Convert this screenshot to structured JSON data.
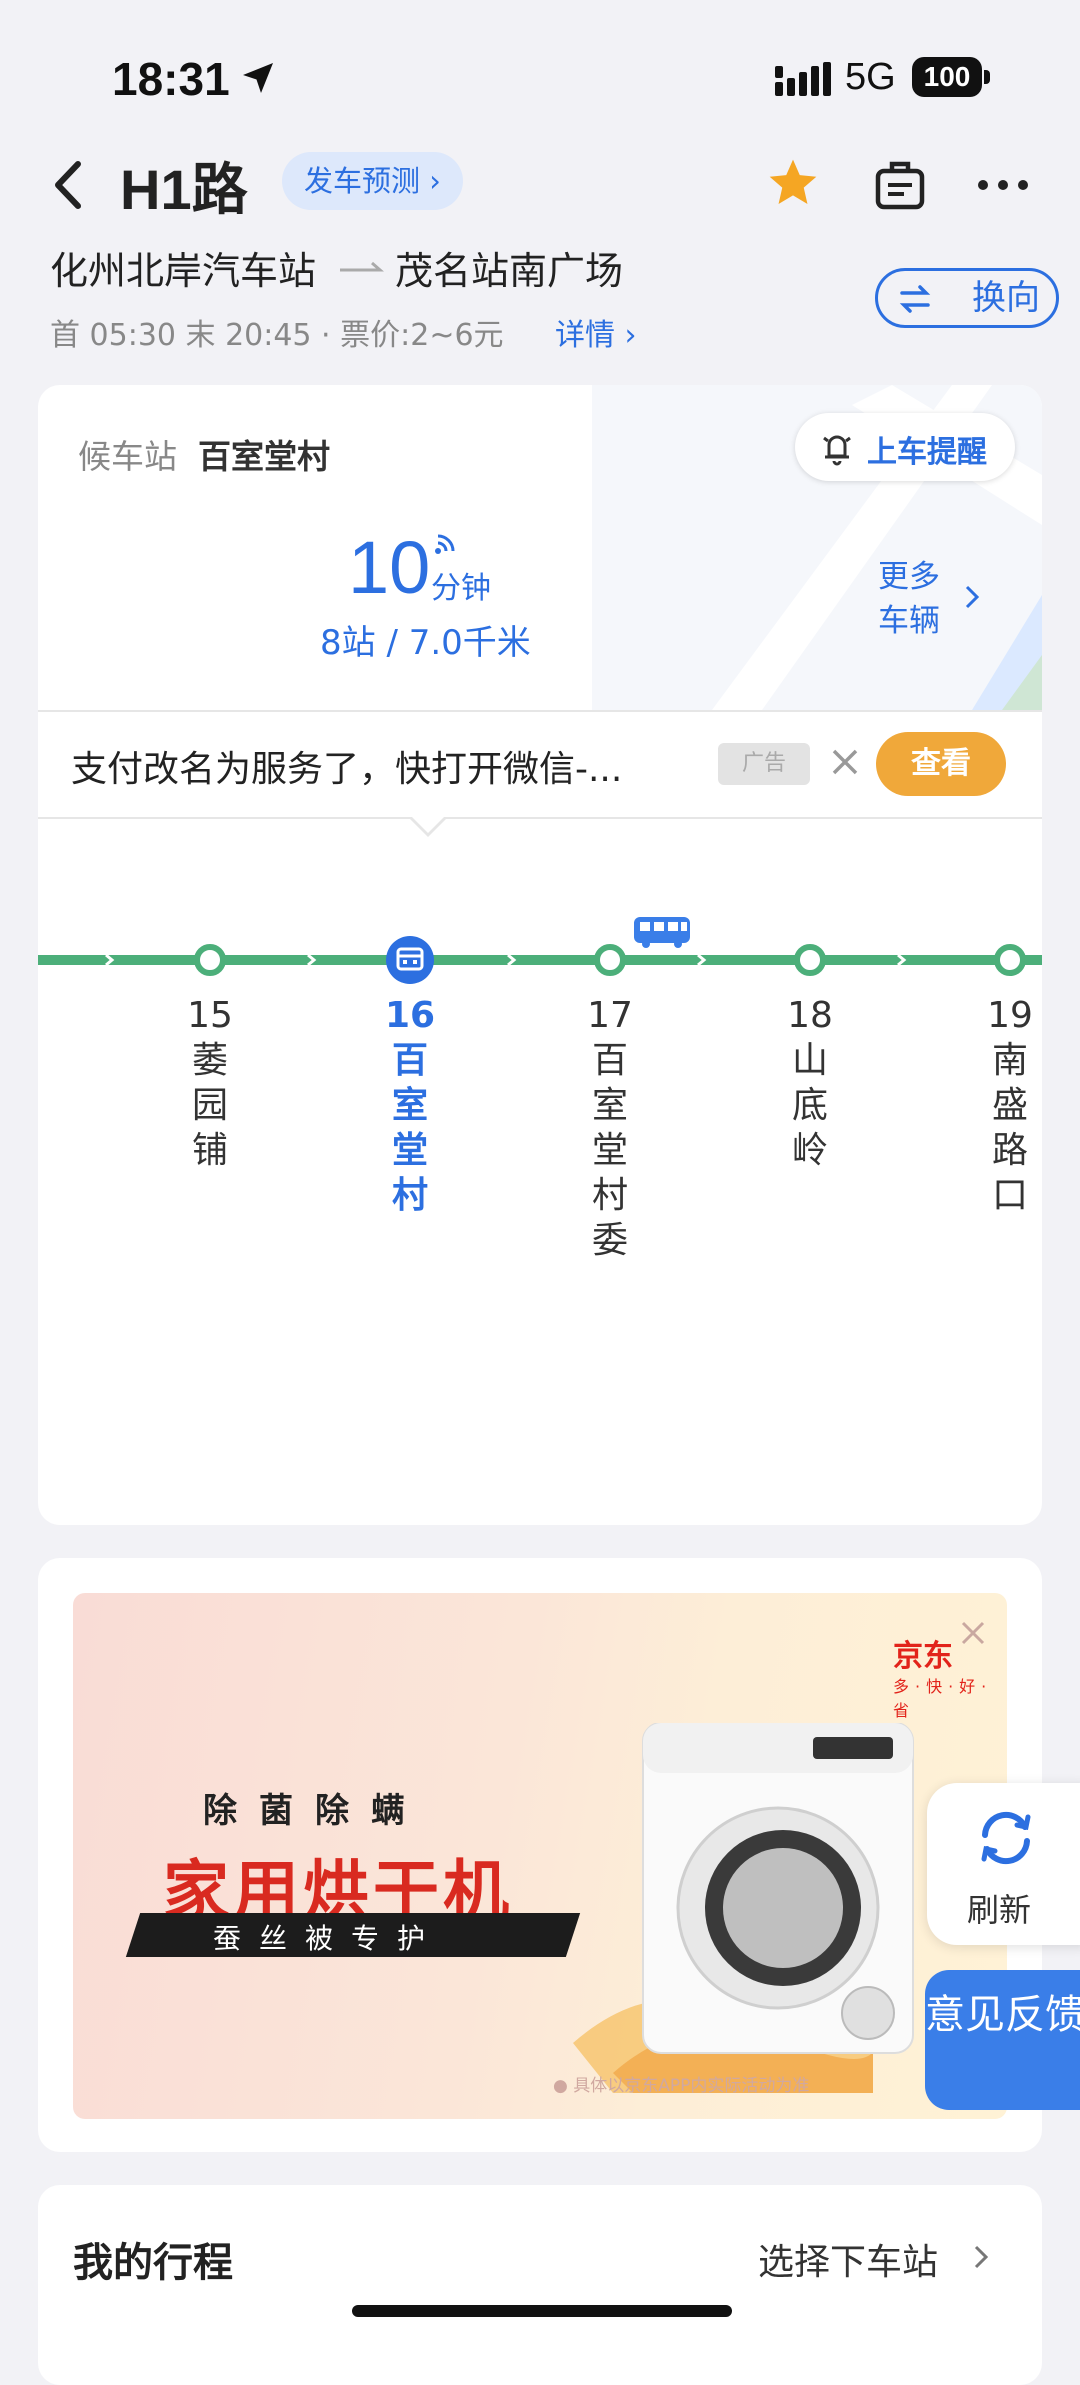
{
  "status_bar": {
    "time": "18:31",
    "network": "5G",
    "battery": "100"
  },
  "header": {
    "route_name": "H1路",
    "depart_predict": "发车预测 ›",
    "swap_label": "换向"
  },
  "route": {
    "from": "化州北岸汽车站",
    "to": "茂名站南广场",
    "times_fare": "首 05:30 末 20:45 · 票价:2~6元",
    "detail_label": "详情 ›"
  },
  "waiting": {
    "label": "候车站",
    "station": "百室堂村",
    "remind_label": "上车提醒",
    "eta_minutes": "10",
    "eta_unit": "分钟",
    "eta_sub": "8站 / 7.0千米",
    "more_vehicles": "更多车辆"
  },
  "inline_ad": {
    "text": "支付改名为服务了，快打开微信-...",
    "badge": "广告",
    "button": "查看"
  },
  "stops": [
    {
      "num": "15",
      "name": "萎园铺",
      "current": false
    },
    {
      "num": "16",
      "name": "百室堂村",
      "current": true
    },
    {
      "num": "17",
      "name": "百室堂村委",
      "current": false
    },
    {
      "num": "18",
      "name": "山底岭",
      "current": false
    },
    {
      "num": "19",
      "name": "南盛路口",
      "current": false
    }
  ],
  "banner": {
    "brand": "京东",
    "brand_sub": "多·快·好·省",
    "slogan_top": "除菌除螨",
    "slogan_main": "家用烘干机",
    "slogan_bottom": "蚕丝被专护",
    "disclaimer": "● 具体以京东APP内实际活动为准"
  },
  "float": {
    "refresh": "刷新",
    "feedback": "意见反馈"
  },
  "trip": {
    "title": "我的行程",
    "pick": "选择下车站"
  },
  "colors": {
    "accent": "#2c6fe0",
    "line": "#4caf7a",
    "view_button": "#f0a83a",
    "star": "#f5a623"
  }
}
